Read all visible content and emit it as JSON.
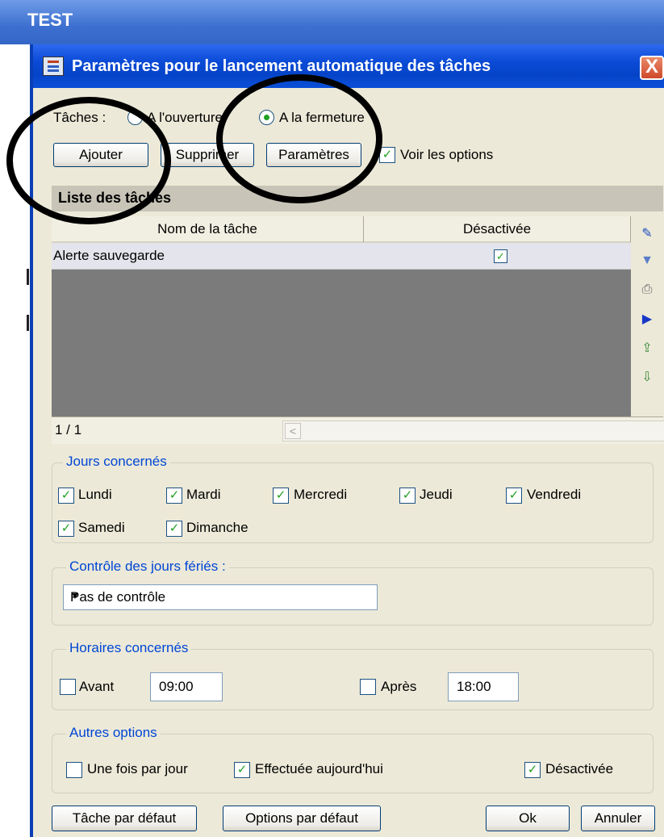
{
  "window": {
    "title": "TEST"
  },
  "dialog": {
    "title": "Paramètres pour le lancement automatique des tâches",
    "close_glyph": "X"
  },
  "taches": {
    "label": "Tâches :",
    "option_ouverture": "A l'ouverture",
    "option_fermeture": "A la fermeture",
    "selected": "A la fermeture"
  },
  "toolbar": {
    "ajouter": "Ajouter",
    "supprimer": "Supprimer",
    "parametres": "Paramètres",
    "voir_options": "Voir les options",
    "voir_options_checked": true
  },
  "task_list": {
    "header": "Liste des tâches",
    "columns": [
      "Nom de la tâche",
      "Désactivée"
    ],
    "rows": [
      {
        "name": "Alerte sauvegarde",
        "disabled": true
      }
    ],
    "pager": "1 / 1"
  },
  "jours": {
    "title": "Jours concernés",
    "items": [
      {
        "label": "Lundi",
        "checked": true
      },
      {
        "label": "Mardi",
        "checked": true
      },
      {
        "label": "Mercredi",
        "checked": true
      },
      {
        "label": "Jeudi",
        "checked": true
      },
      {
        "label": "Vendredi",
        "checked": true
      },
      {
        "label": "Samedi",
        "checked": true
      },
      {
        "label": "Dimanche",
        "checked": true
      }
    ]
  },
  "feries": {
    "title": "Contrôle des jours fériés :",
    "selected": "Pas de contrôle"
  },
  "horaires": {
    "title": "Horaires concernés",
    "avant_label": "Avant",
    "avant_checked": false,
    "avant_value": "09:00",
    "apres_label": "Après",
    "apres_checked": false,
    "apres_value": "18:00"
  },
  "autres": {
    "title": "Autres options",
    "une_fois": "Une fois par jour",
    "une_fois_checked": false,
    "effectuee": "Effectuée aujourd'hui",
    "effectuee_checked": true,
    "desactivee": "Désactivée",
    "desactivee_checked": true
  },
  "bottom": {
    "tache_defaut": "Tâche par défaut",
    "options_defaut": "Options par défaut",
    "ok": "Ok",
    "annuler": "Annuler"
  }
}
